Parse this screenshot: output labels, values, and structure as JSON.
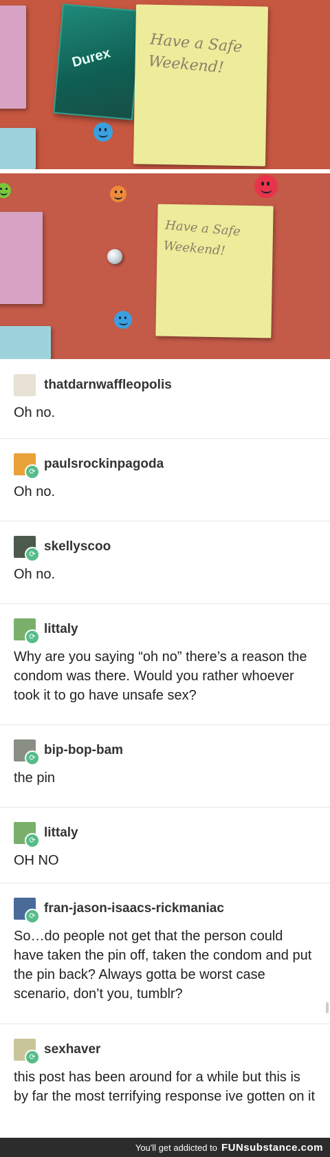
{
  "photo1": {
    "note_text": "Have a Safe\nWeekend!",
    "condom_brand": "Durex"
  },
  "photo2": {
    "note_text": "Have a Safe\nWeekend!"
  },
  "comments": [
    {
      "username": "thatdarnwaffleopolis",
      "text": "Oh no."
    },
    {
      "username": "paulsrockinpagoda",
      "text": "Oh no."
    },
    {
      "username": "skellyscoo",
      "text": "Oh no."
    },
    {
      "username": "littaly",
      "text": "Why are you saying “oh no” there’s a reason the condom was there. Would you rather whoever took it to go have unsafe sex?"
    },
    {
      "username": "bip-bop-bam",
      "text": "the pin"
    },
    {
      "username": "littaly",
      "text": "OH NO"
    },
    {
      "username": "fran-jason-isaacs-rickmaniac",
      "text": "So…do people not get that the person could have taken the pin off, taken the condom and put the pin back? Always gotta be worst case scenario, don’t you, tumblr?"
    },
    {
      "username": "sexhaver",
      "text": "this post has been around for a while but this is by far the most terrifying response ive gotten on it"
    }
  ],
  "footer": {
    "tagline": "You'll get addicted to",
    "brand": "FUNsubstance.com"
  },
  "colors": {
    "board": "#c65740",
    "sticky": "#ecec9a",
    "reblog": "#56bc8a"
  },
  "icons": {
    "reblog": "reblog-icon"
  }
}
